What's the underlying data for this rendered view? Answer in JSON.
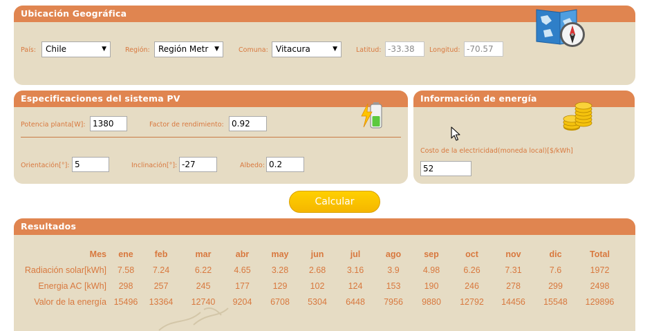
{
  "ubicacion": {
    "title": "Ubicación Geográfica",
    "pais_label": "País:",
    "pais_value": "Chile",
    "region_label": "Región:",
    "region_value": "Región Metr",
    "comuna_label": "Comuna:",
    "comuna_value": "Vitacura",
    "latitud_label": "Latitud:",
    "latitud_value": "-33.38",
    "longitud_label": "Longitud:",
    "longitud_value": "-70.57",
    "icon": "map-compass-icon"
  },
  "especificaciones": {
    "title": "Especificaciones del sistema PV",
    "potencia_label": "Potencia planta[W]:",
    "potencia_value": "1380",
    "factor_label": "Factor de rendimiento:",
    "factor_value": "0.92",
    "orientacion_label": "Orientación[°]:",
    "orientacion_value": "5",
    "inclinacion_label": "Inclinación[°]:",
    "inclinacion_value": "-27",
    "albedo_label": "Albedo:",
    "albedo_value": "0.2",
    "icon": "battery-charging-icon"
  },
  "energia": {
    "title": "Información de energía",
    "costo_label": "Costo de la electricidad(moneda local)[$/kWh]",
    "costo_value": "52",
    "icon": "coins-icon"
  },
  "calcular_label": "Calcular",
  "resultados": {
    "title": "Resultados",
    "header": [
      "Mes",
      "ene",
      "feb",
      "mar",
      "abr",
      "may",
      "jun",
      "jul",
      "ago",
      "sep",
      "oct",
      "nov",
      "dic",
      "Total"
    ],
    "rows": [
      [
        "Radiación solar[kWh]",
        "7.58",
        "7.24",
        "6.22",
        "4.65",
        "3.28",
        "2.68",
        "3.16",
        "3.9",
        "4.98",
        "6.26",
        "7.31",
        "7.6",
        "1972"
      ],
      [
        "Energia AC [kWh]",
        "298",
        "257",
        "245",
        "177",
        "129",
        "102",
        "124",
        "153",
        "190",
        "246",
        "278",
        "299",
        "2498"
      ],
      [
        "Valor de la energía",
        "15496",
        "13364",
        "12740",
        "9204",
        "6708",
        "5304",
        "6448",
        "7956",
        "9880",
        "12792",
        "14456",
        "15548",
        "129896"
      ]
    ]
  },
  "colors": {
    "header": "#e08550",
    "panel": "#e6dcc4",
    "label": "#d8783e",
    "button": "#ffc800"
  }
}
